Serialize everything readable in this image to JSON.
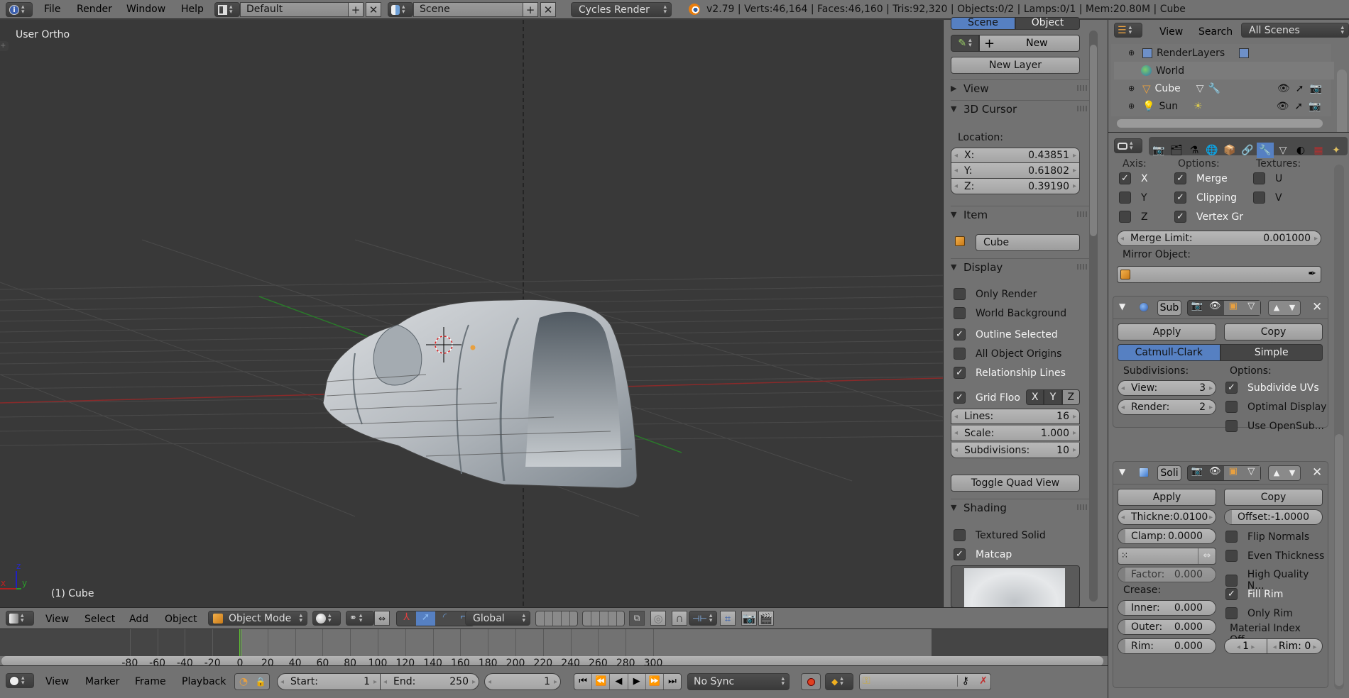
{
  "topbar": {
    "info_icon": "info-icon",
    "menus": [
      "File",
      "Render",
      "Window",
      "Help"
    ],
    "screen_layout": "Default",
    "scene": "Scene",
    "render_engine": "Cycles Render",
    "stats": "v2.79 | Verts:46,164 | Faces:46,160 | Tris:92,320 | Objects:0/2 | Lamps:0/1 | Mem:20.80M | Cube"
  },
  "viewport": {
    "view_label": "User Ortho",
    "object_label": "(1) Cube",
    "axis_labels": {
      "x": "x",
      "y": "y",
      "z": "z"
    },
    "colors": {
      "x_axis": "#b02020",
      "y_axis": "#2a9a2a",
      "z_axis": "#2020c0",
      "bg": "#393939"
    }
  },
  "npanel": {
    "tabs": [
      "Scene",
      "Object"
    ],
    "active_tab": "Scene",
    "new_label": "New",
    "new_layer_label": "New Layer",
    "sections": {
      "view": "View",
      "cursor": "3D Cursor",
      "item": "Item",
      "display": "Display",
      "shading": "Shading"
    },
    "cursor": {
      "location_label": "Location:",
      "x_label": "X:",
      "x": "0.43851",
      "y_label": "Y:",
      "y": "0.61802",
      "z_label": "Z:",
      "z": "0.39190"
    },
    "item_name": "Cube",
    "display": {
      "options": [
        {
          "label": "Only Render",
          "checked": false
        },
        {
          "label": "World Background",
          "checked": false
        },
        {
          "label": "Outline Selected",
          "checked": true
        },
        {
          "label": "All Object Origins",
          "checked": false
        },
        {
          "label": "Relationship Lines",
          "checked": true
        }
      ],
      "grid_floor": {
        "label": "Grid Floo",
        "checked": true
      },
      "axes": [
        "X",
        "Y",
        "Z"
      ],
      "lines_label": "Lines:",
      "lines": "16",
      "scale_label": "Scale:",
      "scale": "1.000",
      "subdiv_label": "Subdivisions:",
      "subdiv": "10",
      "toggle_quad": "Toggle Quad View"
    },
    "shading": {
      "textured_solid": {
        "label": "Textured Solid",
        "checked": false
      },
      "matcap": {
        "label": "Matcap",
        "checked": true
      }
    }
  },
  "outliner": {
    "menus": [
      "View",
      "Search"
    ],
    "filter": "All Scenes",
    "items": [
      {
        "label": "RenderLayers",
        "icon": "render-layers-icon"
      },
      {
        "label": "World",
        "icon": "world-icon"
      },
      {
        "label": "Cube",
        "icon": "mesh-object-icon"
      },
      {
        "label": "Sun",
        "icon": "lamp-icon"
      }
    ]
  },
  "properties": {
    "mirror": {
      "axis_header": "Axis:",
      "options_header": "Options:",
      "textures_header": "Textures:",
      "axis": [
        {
          "label": "X",
          "checked": true
        },
        {
          "label": "Y",
          "checked": false
        },
        {
          "label": "Z",
          "checked": false
        }
      ],
      "options": [
        {
          "label": "Merge",
          "checked": true
        },
        {
          "label": "Clipping",
          "checked": true
        },
        {
          "label": "Vertex Gr",
          "checked": true
        }
      ],
      "textures": [
        {
          "label": "U",
          "checked": false
        },
        {
          "label": "V",
          "checked": false
        }
      ],
      "merge_limit_label": "Merge Limit:",
      "merge_limit": "0.001000",
      "mirror_object_label": "Mirror Object:"
    },
    "subsurf": {
      "name": "Sub",
      "apply": "Apply",
      "copy": "Copy",
      "types": [
        "Catmull-Clark",
        "Simple"
      ],
      "active_type": "Catmull-Clark",
      "subdivisions_header": "Subdivisions:",
      "options_header": "Options:",
      "view_label": "View:",
      "view": "3",
      "render_label": "Render:",
      "render": "2",
      "options": [
        {
          "label": "Subdivide UVs",
          "checked": true
        },
        {
          "label": "Optimal Display",
          "checked": false
        },
        {
          "label": "Use OpenSub...",
          "checked": false
        }
      ]
    },
    "solidify": {
      "name": "Soli",
      "apply": "Apply",
      "copy": "Copy",
      "thickness": "Thickne:0.0100",
      "offset_label": "Offset:",
      "offset": "-1.0000",
      "clamp_label": "Clamp:",
      "clamp": "0.0000",
      "factor_label": "Factor:",
      "factor": "0.000",
      "crease_header": "Crease:",
      "inner_label": "Inner:",
      "inner": "0.000",
      "outer_label": "Outer:",
      "outer": "0.000",
      "rim_label": "Rim:",
      "rim": "0.000",
      "options": [
        {
          "label": "Flip Normals",
          "checked": false
        },
        {
          "label": "Even Thickness",
          "checked": false
        },
        {
          "label": "High Quality N...",
          "checked": false
        },
        {
          "label": "Fill Rim",
          "checked": true
        },
        {
          "label": "Only Rim",
          "checked": false
        }
      ],
      "material_offset_header": "Material Index Off...",
      "mat_index": "1",
      "mat_rim": "Rim: 0"
    }
  },
  "viewport_header": {
    "menus": [
      "View",
      "Select",
      "Add",
      "Object"
    ],
    "mode": "Object Mode",
    "orientation": "Global"
  },
  "timeline": {
    "ticks": [
      "-80",
      "-60",
      "-40",
      "-20",
      "0",
      "20",
      "40",
      "60",
      "80",
      "100",
      "120",
      "140",
      "160",
      "180",
      "200",
      "220",
      "240",
      "260",
      "280",
      "300"
    ],
    "current_frame": 0,
    "frame_range_end": 250
  },
  "timeline_header": {
    "menus": [
      "View",
      "Marker",
      "Frame",
      "Playback"
    ],
    "start_label": "Start:",
    "start": "1",
    "end_label": "End:",
    "end": "250",
    "current": "1",
    "sync": "No Sync"
  }
}
